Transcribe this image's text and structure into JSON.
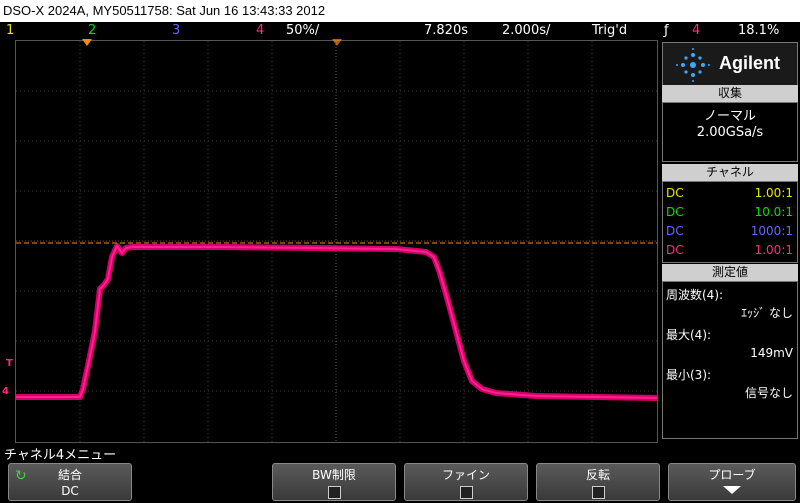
{
  "titlebar": {
    "text": "DSO-X 2024A, MY50511758: Sat Jun 16 13:43:33 2012"
  },
  "status": {
    "ch1": "1",
    "ch2": "2",
    "ch3": "3",
    "ch4": "4",
    "vscale": "50%/",
    "time_offset": "7.820s",
    "time_scale": "2.000s/",
    "trigger_state": "Trig'd",
    "trigger_source": "4",
    "trigger_level": "18.1%"
  },
  "colors": {
    "ch1": "#e8e800",
    "ch2": "#00e000",
    "ch3": "#6464ff",
    "ch4": "#ff2a7f",
    "trace": "#d4006a",
    "trigger": "#ff8c00"
  },
  "brand": {
    "name": "Agilent"
  },
  "acquisition": {
    "header": "収集",
    "mode": "ノーマル",
    "rate": "2.00GSa/s"
  },
  "channels": {
    "header": "チャネル",
    "rows": [
      {
        "coupling": "DC",
        "probe": "1.00:1"
      },
      {
        "coupling": "DC",
        "probe": "10.0:1"
      },
      {
        "coupling": "DC",
        "probe": "1000:1"
      },
      {
        "coupling": "DC",
        "probe": "1.00:1"
      }
    ]
  },
  "measurements": {
    "header": "測定値",
    "items": [
      {
        "label": "周波数(4):",
        "value": "ｴｯｼﾞ なし"
      },
      {
        "label": "最大(4):",
        "value": "149mV"
      },
      {
        "label": "最小(3):",
        "value": "信号なし"
      }
    ]
  },
  "menu": {
    "title": "チャネル4メニュー",
    "softkeys": [
      {
        "label": "結合",
        "value": "DC"
      },
      {
        "label": "BW制限",
        "value": ""
      },
      {
        "label": "ファイン",
        "value": ""
      },
      {
        "label": "反転",
        "value": ""
      },
      {
        "label": "プローブ",
        "value": ""
      }
    ]
  },
  "markers": {
    "trigger_marker": "T",
    "channel_marker": "4"
  }
}
